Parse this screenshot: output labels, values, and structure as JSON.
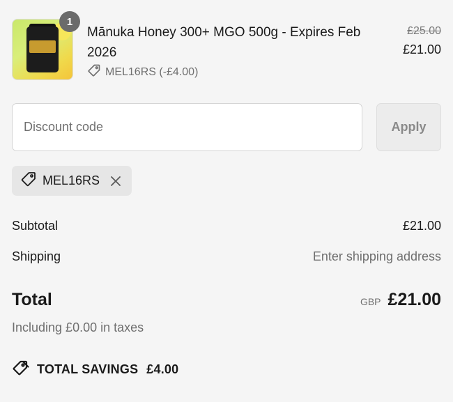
{
  "product": {
    "quantity": "1",
    "name": "Mānuka Honey 300+ MGO 500g - Expires Feb 2026",
    "discount_code_label": "MEL16RS (-£4.00)",
    "price_original": "£25.00",
    "price_current": "£21.00",
    "image_icon": "honey-jar-image"
  },
  "discount": {
    "placeholder": "Discount code",
    "apply_label": "Apply",
    "applied_code": "MEL16RS"
  },
  "summary": {
    "subtotal_label": "Subtotal",
    "subtotal_value": "£21.00",
    "shipping_label": "Shipping",
    "shipping_value": "Enter shipping address",
    "total_label": "Total",
    "currency": "GBP",
    "total_value": "£21.00",
    "taxes_note": "Including £0.00 in taxes",
    "savings_label": "TOTAL SAVINGS",
    "savings_value": "£4.00"
  },
  "colors": {
    "background": "#f5f5f5",
    "text": "#1a1a1a",
    "muted": "#6f6f6f",
    "badge": "#6b6b6b",
    "chip": "#e6e6e6"
  }
}
